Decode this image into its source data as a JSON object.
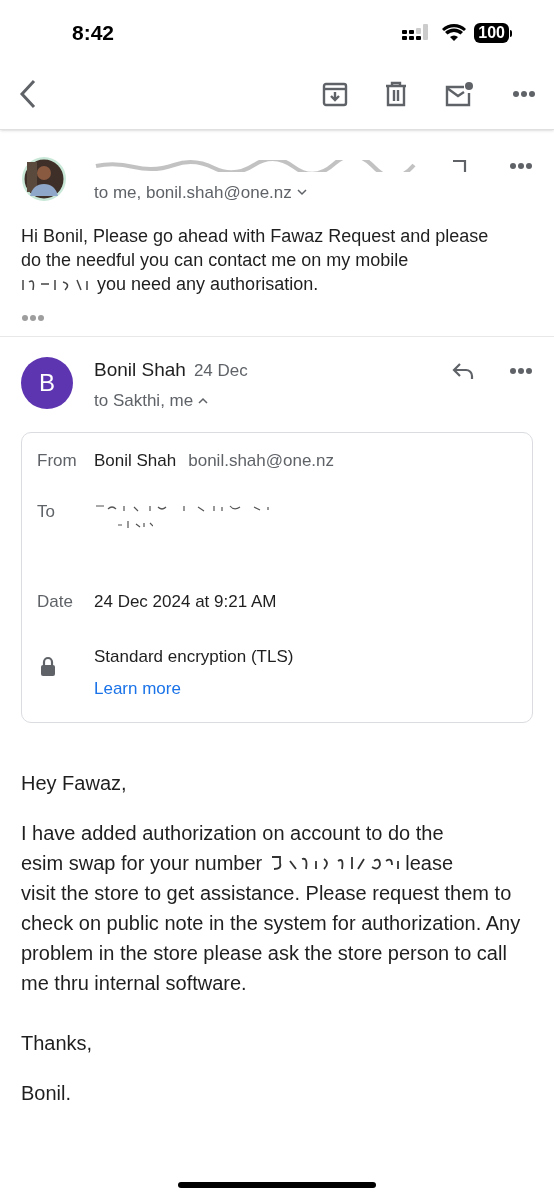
{
  "status_bar": {
    "time": "8:42",
    "battery": "100"
  },
  "messages": [
    {
      "recipients": "to me, bonil.shah@one.nz",
      "expanded": false,
      "body_before": "Hi Bonil, Please go ahead with Fawaz Request and please do the needful you can contact me on my mobile",
      "body_after": "you need any authorisation."
    },
    {
      "avatar_letter": "B",
      "sender": "Bonil Shah",
      "date": "24 Dec",
      "recipients": "to Sakthi, me",
      "expanded": true,
      "details": {
        "from_label": "From",
        "from_name": "Bonil Shah",
        "from_email": "bonil.shah@one.nz",
        "to_label": "To",
        "date_label": "Date",
        "date_value": "24 Dec 2024 at 9:21 AM",
        "encryption": "Standard encryption (TLS)",
        "learn_more": "Learn more"
      },
      "greeting": "Hey Fawaz,",
      "body_lines": [
        "I have added authorization on account to do the",
        "esim swap for your number",
        "lease",
        "visit the store to get assistance. Please request them to check on public note in the system for authorization. Any problem in the store please ask the store person to call me thru internal software."
      ],
      "closing": "Thanks,",
      "signature": "Bonil."
    }
  ]
}
